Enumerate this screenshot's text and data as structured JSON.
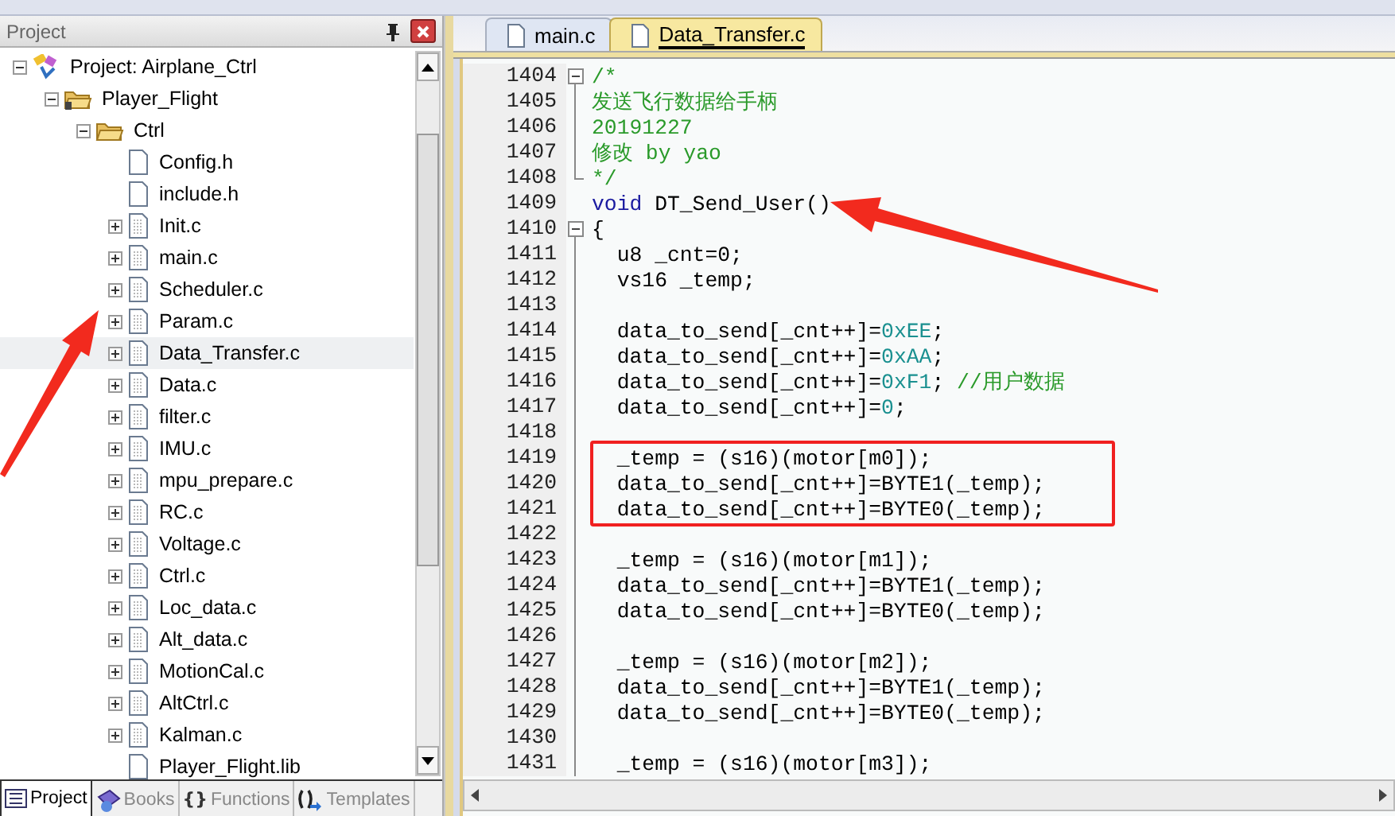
{
  "project_panel": {
    "title": "Project",
    "tree": [
      {
        "label": "Project: Airplane_Ctrl",
        "kind": "project",
        "expanded": true,
        "selected": false,
        "children": [
          {
            "label": "Player_Flight",
            "kind": "group",
            "expanded": true,
            "selected": false,
            "children": [
              {
                "label": "Ctrl",
                "kind": "folder",
                "expanded": true,
                "selected": false,
                "children": [
                  {
                    "label": "Config.h",
                    "kind": "header",
                    "selected": false
                  },
                  {
                    "label": "include.h",
                    "kind": "header",
                    "selected": false
                  },
                  {
                    "label": "Init.c",
                    "kind": "source",
                    "expanded": false,
                    "selected": false
                  },
                  {
                    "label": "main.c",
                    "kind": "source",
                    "expanded": false,
                    "selected": false
                  },
                  {
                    "label": "Scheduler.c",
                    "kind": "source",
                    "expanded": false,
                    "selected": false
                  },
                  {
                    "label": "Param.c",
                    "kind": "source",
                    "expanded": false,
                    "selected": false
                  },
                  {
                    "label": "Data_Transfer.c",
                    "kind": "source",
                    "expanded": false,
                    "selected": true
                  },
                  {
                    "label": "Data.c",
                    "kind": "source",
                    "expanded": false,
                    "selected": false
                  },
                  {
                    "label": "filter.c",
                    "kind": "source",
                    "expanded": false,
                    "selected": false
                  },
                  {
                    "label": "IMU.c",
                    "kind": "source",
                    "expanded": false,
                    "selected": false
                  },
                  {
                    "label": "mpu_prepare.c",
                    "kind": "source",
                    "expanded": false,
                    "selected": false
                  },
                  {
                    "label": "RC.c",
                    "kind": "source",
                    "expanded": false,
                    "selected": false
                  },
                  {
                    "label": "Voltage.c",
                    "kind": "source",
                    "expanded": false,
                    "selected": false
                  },
                  {
                    "label": "Ctrl.c",
                    "kind": "source",
                    "expanded": false,
                    "selected": false
                  },
                  {
                    "label": "Loc_data.c",
                    "kind": "source",
                    "expanded": false,
                    "selected": false
                  },
                  {
                    "label": "Alt_data.c",
                    "kind": "source",
                    "expanded": false,
                    "selected": false
                  },
                  {
                    "label": "MotionCal.c",
                    "kind": "source",
                    "expanded": false,
                    "selected": false
                  },
                  {
                    "label": "AltCtrl.c",
                    "kind": "source",
                    "expanded": false,
                    "selected": false
                  },
                  {
                    "label": "Kalman.c",
                    "kind": "source",
                    "expanded": false,
                    "selected": false
                  },
                  {
                    "label": "Player_Flight.lib",
                    "kind": "library",
                    "selected": false
                  }
                ]
              }
            ]
          }
        ]
      }
    ],
    "bottom_tabs": [
      {
        "label": "Project",
        "kind": "project",
        "selected": true
      },
      {
        "label": "Books",
        "kind": "books",
        "selected": false
      },
      {
        "label": "Functions",
        "kind": "functions",
        "glyph": "{}",
        "selected": false
      },
      {
        "label": "Templates",
        "kind": "templates",
        "selected": false
      }
    ]
  },
  "editor": {
    "tabs": [
      {
        "label": "main.c",
        "selected": false
      },
      {
        "label": "Data_Transfer.c",
        "selected": true
      }
    ],
    "lines": [
      {
        "kind": "line",
        "number": "1404",
        "fold_start": true,
        "fold_end": false,
        "tokens": [
          {
            "kind": "comment",
            "text": "/*"
          }
        ]
      },
      {
        "kind": "line",
        "number": "1405",
        "fold_start": false,
        "fold_end": false,
        "tokens": [
          {
            "kind": "comment",
            "text": "发送飞行数据给手柄"
          }
        ]
      },
      {
        "kind": "line",
        "number": "1406",
        "fold_start": false,
        "fold_end": false,
        "tokens": [
          {
            "kind": "comment",
            "text": "20191227"
          }
        ]
      },
      {
        "kind": "line",
        "number": "1407",
        "fold_start": false,
        "fold_end": false,
        "tokens": [
          {
            "kind": "comment",
            "text": "修改 by yao"
          }
        ]
      },
      {
        "kind": "line",
        "number": "1408",
        "fold_start": false,
        "fold_end": true,
        "tokens": [
          {
            "kind": "comment",
            "text": "*/"
          }
        ]
      },
      {
        "kind": "line",
        "number": "1409",
        "fold_start": false,
        "fold_end": false,
        "tokens": [
          {
            "kind": "keyword",
            "text": "void"
          },
          {
            "kind": "plain",
            "text": " DT_Send_User()"
          }
        ]
      },
      {
        "kind": "line",
        "number": "1410",
        "fold_start": true,
        "fold_end": false,
        "tokens": [
          {
            "kind": "plain",
            "text": "{"
          }
        ]
      },
      {
        "kind": "line",
        "number": "1411",
        "fold_start": false,
        "fold_end": false,
        "tokens": [
          {
            "kind": "plain",
            "text": "  u8 _cnt=0;"
          }
        ]
      },
      {
        "kind": "line",
        "number": "1412",
        "fold_start": false,
        "fold_end": false,
        "tokens": [
          {
            "kind": "plain",
            "text": "  vs16 _temp;"
          }
        ]
      },
      {
        "kind": "line",
        "number": "1413",
        "fold_start": false,
        "fold_end": false
      },
      {
        "kind": "line",
        "number": "1414",
        "fold_start": false,
        "fold_end": false,
        "tokens": [
          {
            "kind": "plain",
            "text": "  data_to_send[_cnt++]="
          },
          {
            "kind": "number",
            "text": "0xEE"
          },
          {
            "kind": "plain",
            "text": ";"
          }
        ]
      },
      {
        "kind": "line",
        "number": "1415",
        "fold_start": false,
        "fold_end": false,
        "tokens": [
          {
            "kind": "plain",
            "text": "  data_to_send[_cnt++]="
          },
          {
            "kind": "number",
            "text": "0xAA"
          },
          {
            "kind": "plain",
            "text": ";"
          }
        ]
      },
      {
        "kind": "line",
        "number": "1416",
        "fold_start": false,
        "fold_end": false,
        "tokens": [
          {
            "kind": "plain",
            "text": "  data_to_send[_cnt++]="
          },
          {
            "kind": "number",
            "text": "0xF1"
          },
          {
            "kind": "plain",
            "text": "; "
          },
          {
            "kind": "comment",
            "text": "//用户数据"
          }
        ]
      },
      {
        "kind": "line",
        "number": "1417",
        "fold_start": false,
        "fold_end": false,
        "tokens": [
          {
            "kind": "plain",
            "text": "  data_to_send[_cnt++]="
          },
          {
            "kind": "number",
            "text": "0"
          },
          {
            "kind": "plain",
            "text": ";"
          }
        ]
      },
      {
        "kind": "line",
        "number": "1418",
        "fold_start": false,
        "fold_end": false
      },
      {
        "kind": "boxed",
        "lines": [
          {
            "number": "1419",
            "fold_start": false,
            "fold_end": false,
            "tokens": [
              {
                "kind": "plain",
                "text": "  _temp = (s16)(motor[m0]);"
              }
            ]
          },
          {
            "number": "1420",
            "fold_start": false,
            "fold_end": false,
            "tokens": [
              {
                "kind": "plain",
                "text": "  data_to_send[_cnt++]=BYTE1(_temp);"
              }
            ]
          },
          {
            "number": "1421",
            "fold_start": false,
            "fold_end": false,
            "tokens": [
              {
                "kind": "plain",
                "text": "  data_to_send[_cnt++]=BYTE0(_temp);"
              }
            ]
          }
        ]
      },
      {
        "kind": "line",
        "number": "1422",
        "fold_start": false,
        "fold_end": false
      },
      {
        "kind": "line",
        "number": "1423",
        "fold_start": false,
        "fold_end": false,
        "tokens": [
          {
            "kind": "plain",
            "text": "  _temp = (s16)(motor[m1]);"
          }
        ]
      },
      {
        "kind": "line",
        "number": "1424",
        "fold_start": false,
        "fold_end": false,
        "tokens": [
          {
            "kind": "plain",
            "text": "  data_to_send[_cnt++]=BYTE1(_temp);"
          }
        ]
      },
      {
        "kind": "line",
        "number": "1425",
        "fold_start": false,
        "fold_end": false,
        "tokens": [
          {
            "kind": "plain",
            "text": "  data_to_send[_cnt++]=BYTE0(_temp);"
          }
        ]
      },
      {
        "kind": "line",
        "number": "1426",
        "fold_start": false,
        "fold_end": false
      },
      {
        "kind": "line",
        "number": "1427",
        "fold_start": false,
        "fold_end": false,
        "tokens": [
          {
            "kind": "plain",
            "text": "  _temp = (s16)(motor[m2]);"
          }
        ]
      },
      {
        "kind": "line",
        "number": "1428",
        "fold_start": false,
        "fold_end": false,
        "tokens": [
          {
            "kind": "plain",
            "text": "  data_to_send[_cnt++]=BYTE1(_temp);"
          }
        ]
      },
      {
        "kind": "line",
        "number": "1429",
        "fold_start": false,
        "fold_end": false,
        "tokens": [
          {
            "kind": "plain",
            "text": "  data_to_send[_cnt++]=BYTE0(_temp);"
          }
        ]
      },
      {
        "kind": "line",
        "number": "1430",
        "fold_start": false,
        "fold_end": false
      },
      {
        "kind": "line",
        "number": "1431",
        "fold_start": false,
        "fold_end": false,
        "tokens": [
          {
            "kind": "plain",
            "text": "  _temp = (s16)(motor[m3]);"
          }
        ]
      }
    ]
  }
}
